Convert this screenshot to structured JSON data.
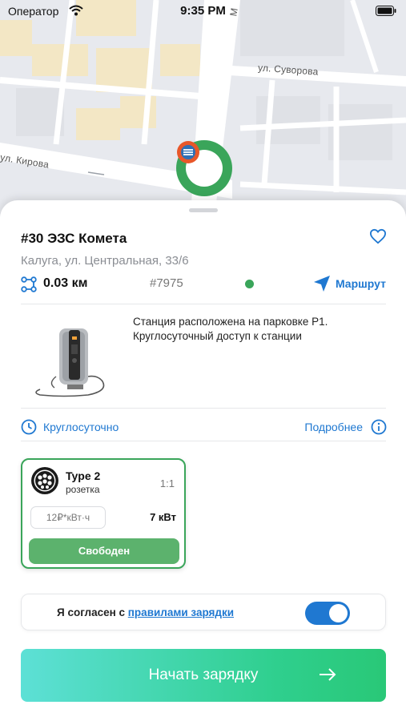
{
  "status_bar": {
    "carrier": "Оператор",
    "time": "9:35 PM"
  },
  "map": {
    "streets": {
      "suvorova": "ул. Суворова",
      "kirova": "ул. Кирова",
      "vertical": "М"
    }
  },
  "station": {
    "title": "#30 ЭЗС Комета",
    "address": "Калуга, ул. Центральная, 33/6",
    "distance": "0.03 км",
    "id": "#7975",
    "status_color": "#3aa55a",
    "route_label": "Маршрут",
    "description": "Станция расположена на парковке Р1. Круглосуточный доступ к станции",
    "hours": "Круглосуточно",
    "more_label": "Подробнее"
  },
  "connector": {
    "type": "Type 2",
    "subtype": "розетка",
    "ratio": "1:1",
    "price": "12₽*кВт·ч",
    "power": "7 кВт",
    "status": "Свободен"
  },
  "agreement": {
    "text": "Я согласен с",
    "link": "правилами зарядки",
    "toggle_on": true
  },
  "start_button": {
    "label": "Начать зарядку"
  },
  "colors": {
    "accent_blue": "#1f78d1",
    "green": "#3aa55a",
    "free_green": "#5cb26d"
  }
}
